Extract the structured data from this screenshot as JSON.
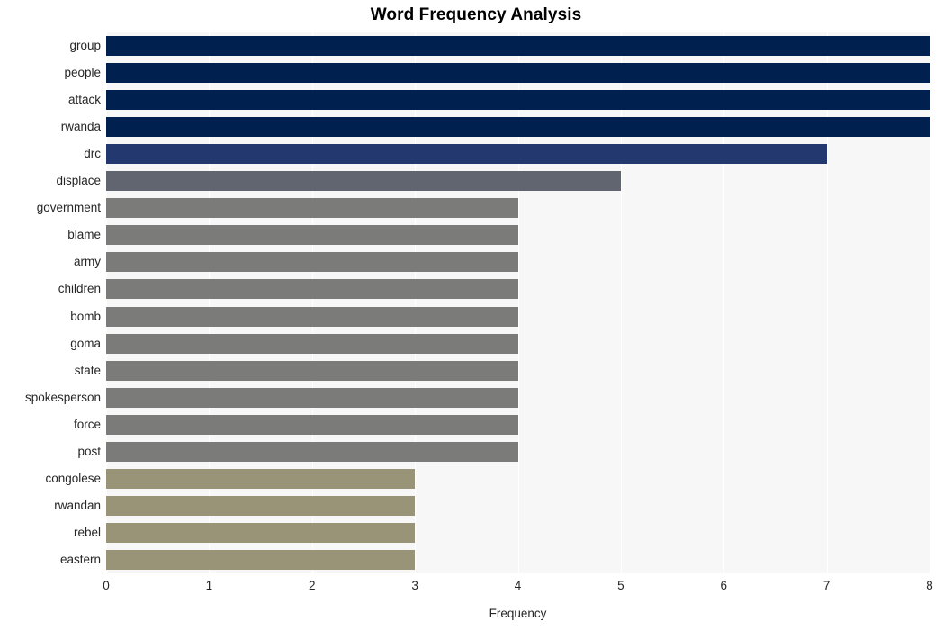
{
  "chart_data": {
    "type": "bar",
    "orientation": "horizontal",
    "title": "Word Frequency Analysis",
    "xlabel": "Frequency",
    "ylabel": "",
    "xlim": [
      0,
      8
    ],
    "ylim": [
      0,
      20
    ],
    "xticks": [
      "0",
      "1",
      "2",
      "3",
      "4",
      "5",
      "6",
      "7",
      "8"
    ],
    "xtick_values": [
      0,
      1,
      2,
      3,
      4,
      5,
      6,
      7,
      8
    ],
    "grid": "vertical-white-on-light-gray",
    "legend": "none",
    "categories": [
      "group",
      "people",
      "attack",
      "rwanda",
      "drc",
      "displace",
      "government",
      "blame",
      "army",
      "children",
      "bomb",
      "goma",
      "state",
      "spokesperson",
      "force",
      "post",
      "congolese",
      "rwandan",
      "rebel",
      "eastern"
    ],
    "values": [
      8,
      8,
      8,
      8,
      7,
      5,
      4,
      4,
      4,
      4,
      4,
      4,
      4,
      4,
      4,
      4,
      3,
      3,
      3,
      3
    ],
    "bar_colors": [
      "#002050",
      "#002050",
      "#002050",
      "#002050",
      "#22386f",
      "#61656f",
      "#7b7b79",
      "#7b7b79",
      "#7b7b79",
      "#7b7b79",
      "#7b7b79",
      "#7b7b79",
      "#7b7b79",
      "#7b7b79",
      "#7b7b79",
      "#7b7b79",
      "#999378",
      "#999378",
      "#999378",
      "#999378"
    ]
  },
  "colors": {
    "figure_background": "#ffffff",
    "plot_background": "#f7f7f7",
    "gridline": "#ffffff",
    "title_text": "#000000",
    "tick_text": "#262626",
    "bar_high": "#002050",
    "bar_seven": "#22386f",
    "bar_five": "#61656f",
    "bar_four": "#7b7b79",
    "bar_three": "#999378"
  }
}
